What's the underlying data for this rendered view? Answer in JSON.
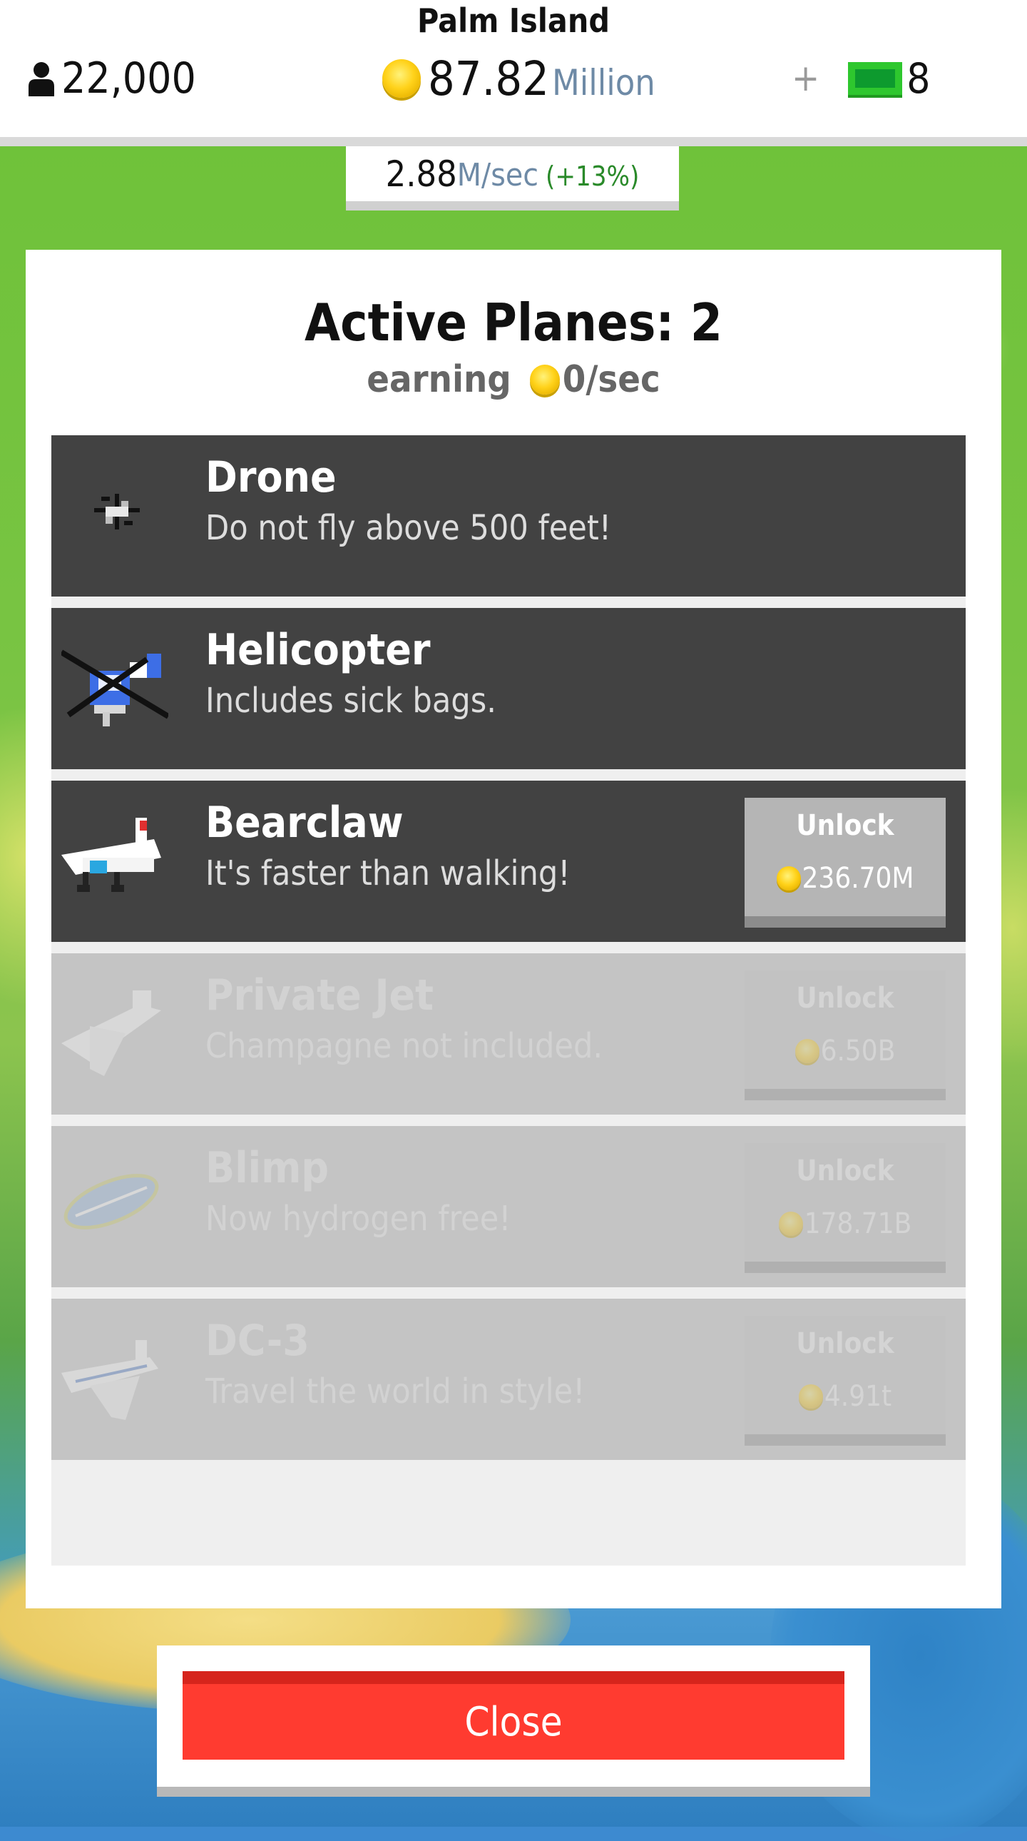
{
  "header": {
    "island_name": "Palm Island",
    "population": "22,000",
    "money_value": "87.82",
    "money_unit": "Million",
    "plus": "+",
    "cash_count": "8",
    "rate_value": "2.88",
    "rate_unit": "M/sec",
    "rate_bonus": "(+13%)"
  },
  "panel": {
    "title": "Active Planes: 2",
    "earning_label": "earning",
    "earning_value": "0/sec"
  },
  "planes": [
    {
      "name": "Drone",
      "desc": "Do not fly above 500 feet!",
      "icon": "drone-icon",
      "state": "owned"
    },
    {
      "name": "Helicopter",
      "desc": "Includes sick bags.",
      "icon": "helicopter-icon",
      "state": "owned"
    },
    {
      "name": "Bearclaw",
      "desc": "It's faster than walking!",
      "icon": "bearclaw-plane-icon",
      "state": "unlockable",
      "unlock_label": "Unlock",
      "cost": "236.70M"
    },
    {
      "name": "Private Jet",
      "desc": "Champagne not included.",
      "icon": "private-jet-icon",
      "state": "locked",
      "unlock_label": "Unlock",
      "cost": "6.50B"
    },
    {
      "name": "Blimp",
      "desc": "Now hydrogen free!",
      "icon": "blimp-icon",
      "state": "locked",
      "unlock_label": "Unlock",
      "cost": "178.71B"
    },
    {
      "name": "DC-3",
      "desc": "Travel the world in style!",
      "icon": "dc3-plane-icon",
      "state": "locked",
      "unlock_label": "Unlock",
      "cost": "4.91t"
    }
  ],
  "close_label": "Close",
  "colors": {
    "close_button": "#ff3b30",
    "row_dark": "#424242",
    "row_disabled": "#c4c4c4",
    "coin": "#ffd21a",
    "bonus_green": "#2a8a2a"
  }
}
